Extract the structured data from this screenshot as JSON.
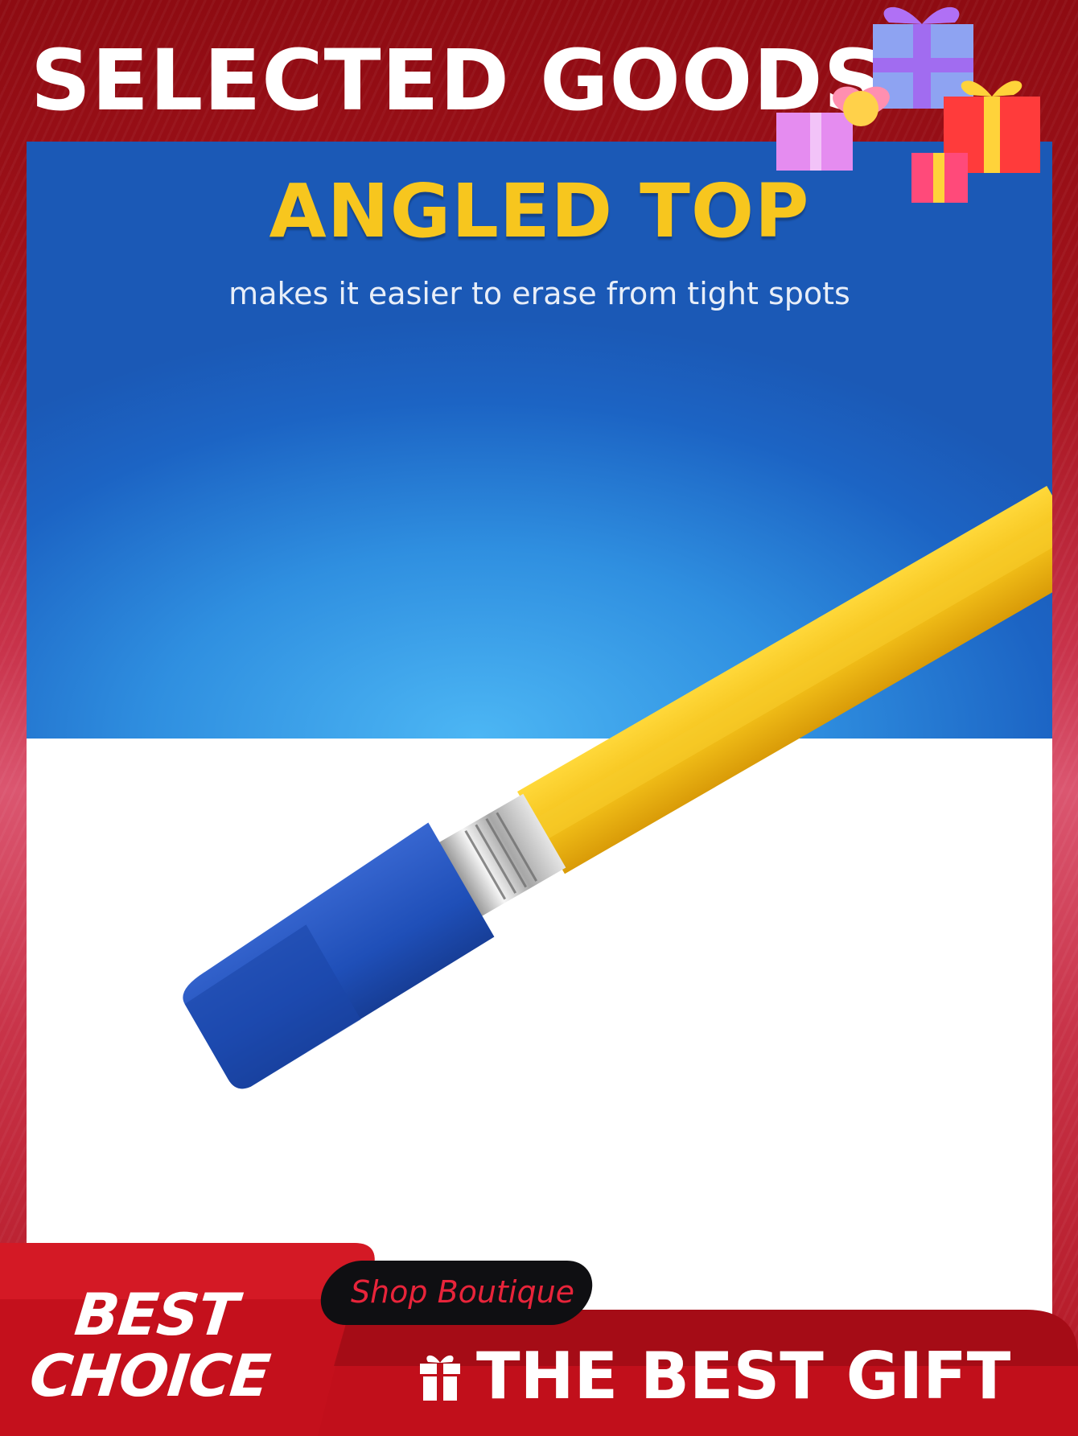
{
  "header": {
    "title": "SELECTED GOODS"
  },
  "product": {
    "heading": "ANGLED TOP",
    "subheading": "makes it easier to erase from tight spots"
  },
  "badge": {
    "line1": "BEST",
    "line2": "CHOICE"
  },
  "shop": {
    "label": "Shop Boutique"
  },
  "footer": {
    "gift_label": "THE BEST GIFT"
  },
  "colors": {
    "frame_red": "#a4131c",
    "heading_yellow": "#f7c61e",
    "sky_blue": "#2f8fe0",
    "eraser_blue": "#1f4fb8",
    "pencil_yellow": "#f4c21a",
    "shop_text_red": "#e8243a"
  },
  "icons": [
    "gift-boxes-icon",
    "gift-icon"
  ]
}
